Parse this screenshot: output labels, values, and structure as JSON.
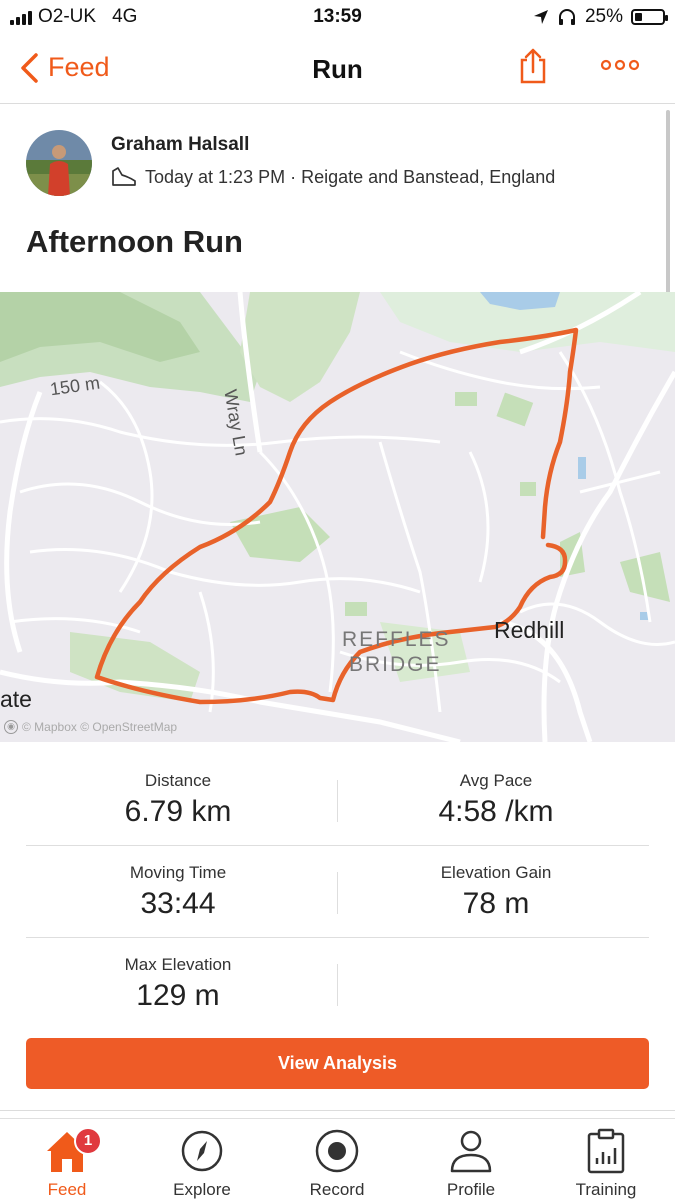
{
  "status_bar": {
    "carrier": "O2-UK",
    "network": "4G",
    "time": "13:59",
    "battery": "25%"
  },
  "nav": {
    "back_label": "Feed",
    "title": "Run"
  },
  "activity": {
    "athlete_name": "Graham Halsall",
    "meta": "Today at 1:23 PM · Reigate and Banstead, England",
    "title": "Afternoon Run"
  },
  "map": {
    "labels": {
      "elevation": "150 m",
      "road": "Wray Ln",
      "district_line1": "REFFLES",
      "district_line2": "BRIDGE",
      "town": "Redhill",
      "town_left": "ate"
    },
    "attribution": "© Mapbox © OpenStreetMap",
    "route_color": "#e8622a"
  },
  "stats": [
    {
      "label": "Distance",
      "value": "6.79 km"
    },
    {
      "label": "Avg Pace",
      "value": "4:58 /km"
    },
    {
      "label": "Moving Time",
      "value": "33:44"
    },
    {
      "label": "Elevation Gain",
      "value": "78 m"
    },
    {
      "label": "Max Elevation",
      "value": "129 m"
    }
  ],
  "actions": {
    "view_analysis": "View Analysis"
  },
  "tabs": [
    {
      "label": "Feed",
      "icon": "home-icon",
      "badge": "1",
      "active": true
    },
    {
      "label": "Explore",
      "icon": "compass-icon"
    },
    {
      "label": "Record",
      "icon": "record-icon"
    },
    {
      "label": "Profile",
      "icon": "profile-icon"
    },
    {
      "label": "Training",
      "icon": "training-icon"
    }
  ],
  "colors": {
    "accent": "#f05a1a",
    "button": "#ee5b27",
    "badge": "#e0393e"
  }
}
